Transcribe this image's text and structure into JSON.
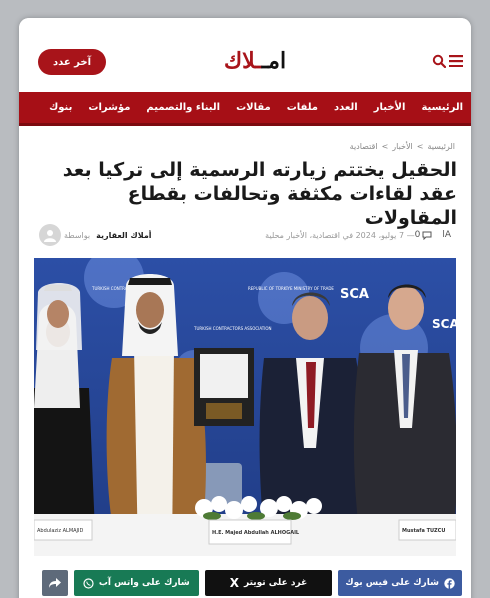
{
  "header": {
    "issue_button": "آخر عدد",
    "logo_text_main": "امـ",
    "logo_text_accent": "ـلاك"
  },
  "nav": {
    "items": [
      "الرئيسية",
      "الأخبار",
      "العدد",
      "ملفات",
      "مقالات",
      "البناء والتصميم",
      "مؤشرات",
      "بنوك"
    ]
  },
  "breadcrumb": {
    "home": "الرئيسية",
    "sep1": ">",
    "news": "الأخبار",
    "sep2": ">",
    "section": "اقتصادية"
  },
  "article": {
    "title": "الحقيل يختتم زيارته الرسمية إلى تركيا بعد عقد لقاءات مكثفة وتحالفات بقطاع المقاولات",
    "by_label": "بواسطة",
    "author": "أملاك العقارية",
    "date_and_tags": "— 7 يوليو، 2024 في اقتصادية، الأخبار محلية",
    "font_size_label": "Aا",
    "comment_count": "0"
  },
  "photo": {
    "backdrop_texts": [
      "SCA",
      "SCA",
      "TURKISH CONTRACTORS ASSOCIATION",
      "REPUBLIC OF TÜRKİYE MINISTRY OF TRADE",
      "TURKISH CONTRACTORS ASSOCIATION"
    ],
    "nameplate_left": "Abdulaziz ALMAJID",
    "nameplate_center": "H.E. Majed Abdullah ALHOGAIL",
    "nameplate_right": "Mustafa TUZCU"
  },
  "share": {
    "facebook": "شارك على فيس بوك",
    "x": "غرد على تويتر",
    "x_glyph": "X",
    "whatsapp": "شارك على واتس آب"
  },
  "colors": {
    "brand_red": "#a60f16",
    "whatsapp_green": "#187a55",
    "facebook_blue": "#3c5ba0"
  }
}
